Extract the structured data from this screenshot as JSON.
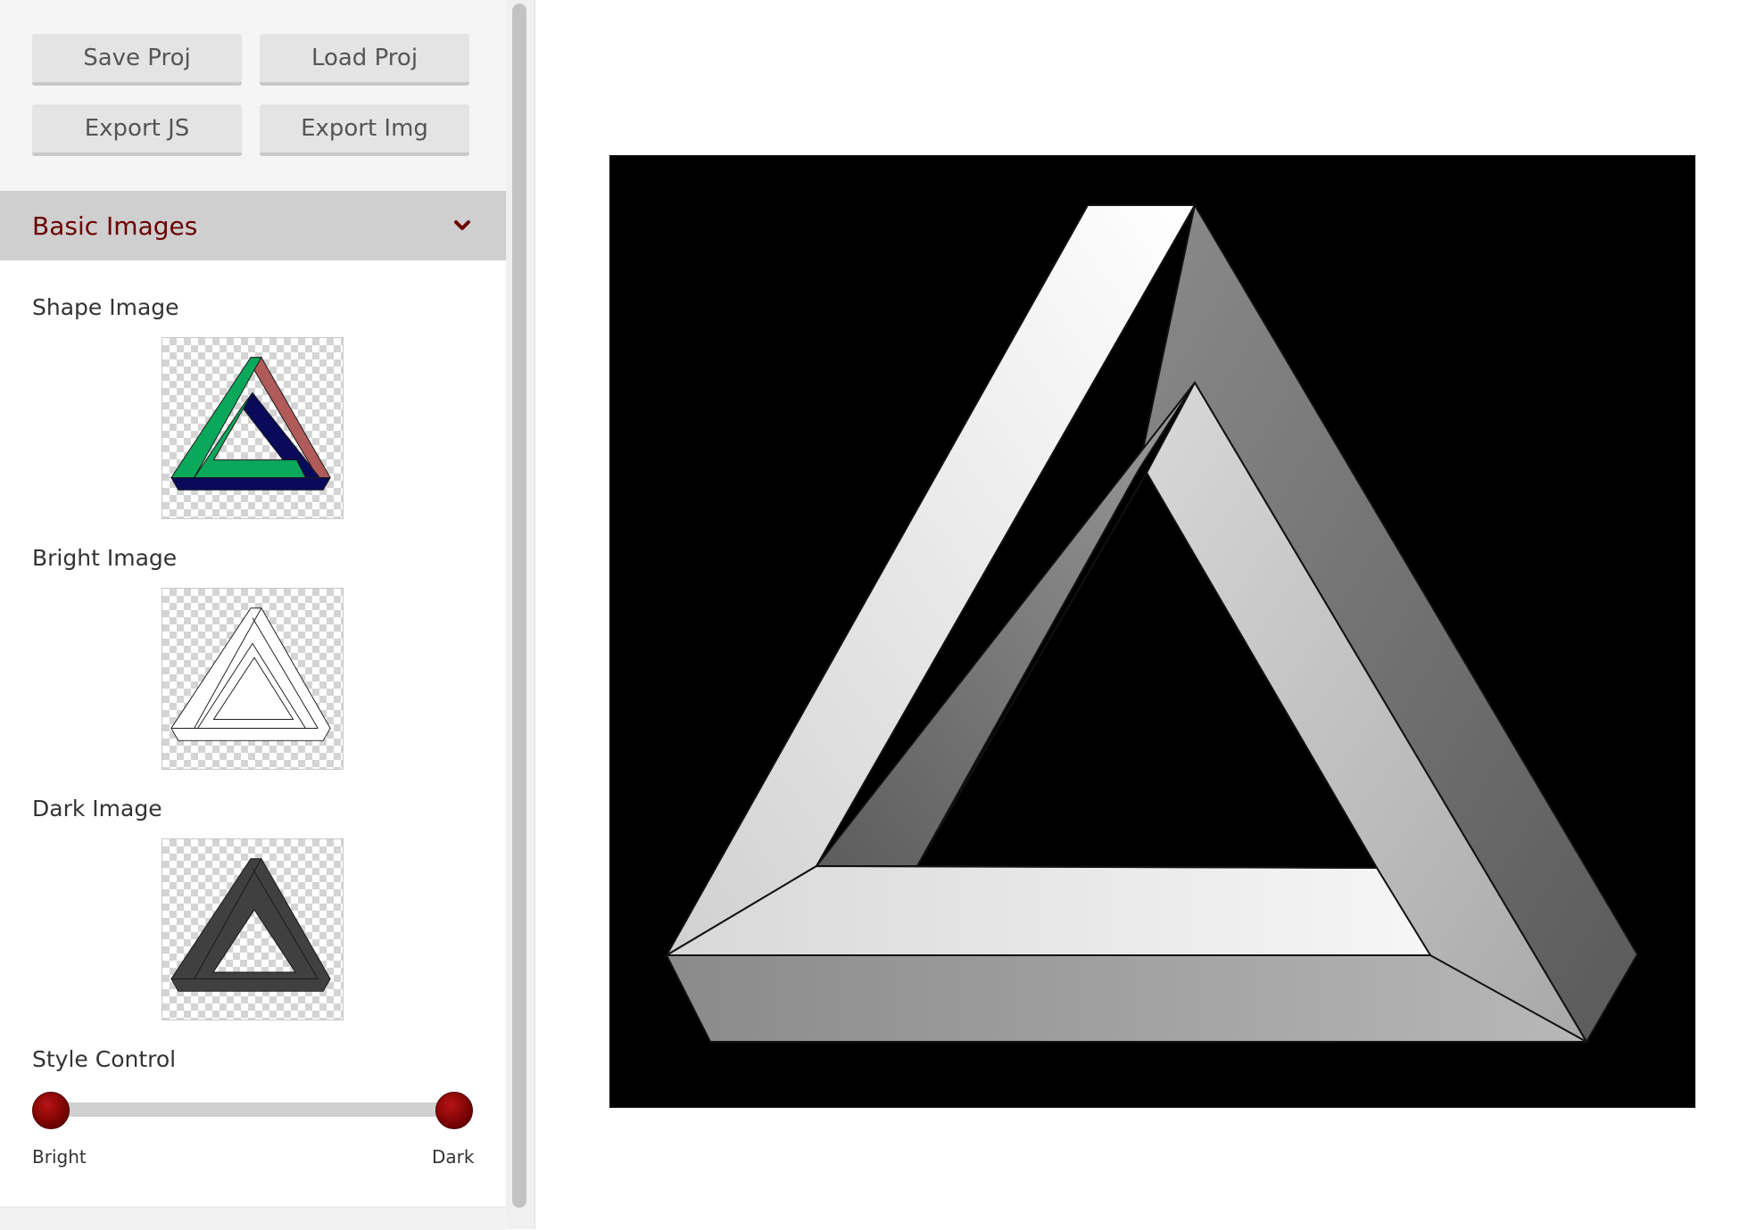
{
  "toolbar": {
    "save_label": "Save Proj",
    "load_label": "Load Proj",
    "export_js_label": "Export JS",
    "export_img_label": "Export Img"
  },
  "panel": {
    "section_title": "Basic Images",
    "section_icon": "chevron-down-icon",
    "shape_label": "Shape Image",
    "bright_label": "Bright Image",
    "dark_label": "Dark Image",
    "style_label": "Style Control",
    "slider": {
      "min_label": "Bright",
      "max_label": "Dark",
      "range_start": 0,
      "range_end": 1
    }
  },
  "colors": {
    "accent": "#6b0000",
    "slider_handle": "#9b0a0a",
    "canvas_bg": "#000000",
    "shape_green": "#0aa85a",
    "shape_red": "#b05a5a",
    "shape_navy": "#0a0a5a"
  }
}
